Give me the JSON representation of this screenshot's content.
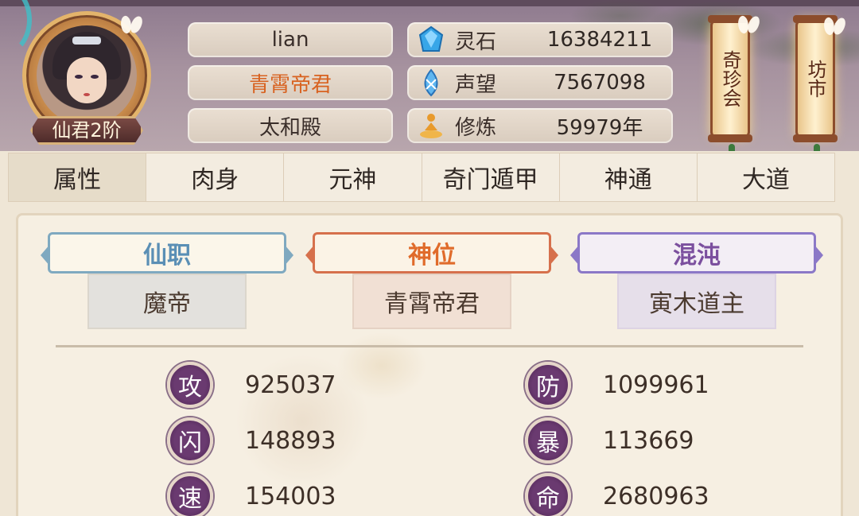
{
  "player": {
    "name": "lian",
    "title": "青霄帝君",
    "location": "太和殿",
    "rank": "仙君2阶"
  },
  "resources": [
    {
      "icon": "spirit-stone-icon",
      "label": "灵石",
      "value": "16384211"
    },
    {
      "icon": "reputation-icon",
      "label": "声望",
      "value": "7567098"
    },
    {
      "icon": "cultivation-icon",
      "label": "修炼",
      "value": "59979年"
    }
  ],
  "lanterns": {
    "treasure": "奇珍会",
    "market": "坊市"
  },
  "tabs": [
    "属性",
    "肉身",
    "元神",
    "奇门遁甲",
    "神通",
    "大道"
  ],
  "active_tab": 0,
  "titles": [
    {
      "header": "仙职",
      "value": "魔帝",
      "color": "#7fa9c0"
    },
    {
      "header": "神位",
      "value": "青霄帝君",
      "color": "#d6704c"
    },
    {
      "header": "混沌",
      "value": "寅木道主",
      "color": "#8b78c7"
    }
  ],
  "stats": [
    {
      "label": "攻",
      "value": "925037"
    },
    {
      "label": "防",
      "value": "1099961"
    },
    {
      "label": "闪",
      "value": "148893"
    },
    {
      "label": "暴",
      "value": "113669"
    },
    {
      "label": "速",
      "value": "154003"
    },
    {
      "label": "命",
      "value": "2680963"
    }
  ]
}
